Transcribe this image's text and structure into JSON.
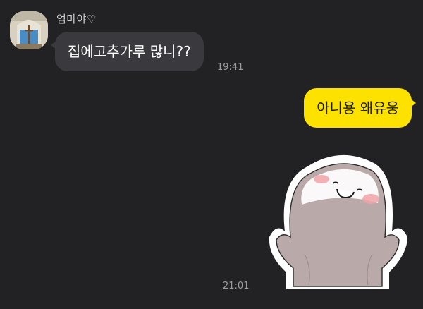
{
  "messages": [
    {
      "direction": "incoming",
      "sender": "엄마야♡",
      "text": "집에고추가루 많니??",
      "time": "19:41"
    },
    {
      "direction": "outgoing",
      "text": "아니용 왜유웅"
    },
    {
      "direction": "outgoing",
      "sticker": "white-ghost-blob-sticker",
      "time": "21:01"
    }
  ],
  "colors": {
    "background": "#222225",
    "incoming_bubble": "#3a3a3e",
    "outgoing_bubble": "#fde200"
  }
}
